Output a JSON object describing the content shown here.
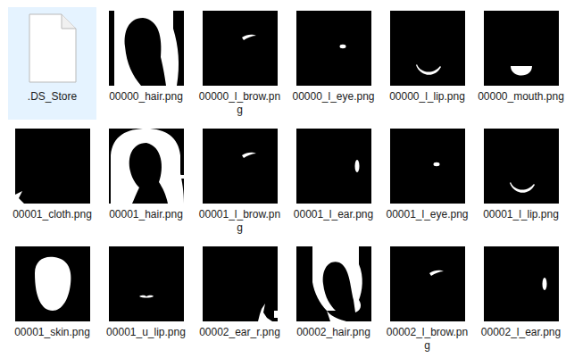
{
  "items": [
    {
      "name": ".DS_Store",
      "kind": "document",
      "selected": true
    },
    {
      "name": "00000_hair.png",
      "kind": "hair",
      "selected": false
    },
    {
      "name": "00000_l_brow.png",
      "kind": "brow",
      "selected": false
    },
    {
      "name": "00000_l_eye.png",
      "kind": "eye",
      "selected": false
    },
    {
      "name": "00000_l_lip.png",
      "kind": "lowerlip",
      "selected": false
    },
    {
      "name": "00000_mouth.png",
      "kind": "mouth",
      "selected": false
    },
    {
      "name": "00001_cloth.png",
      "kind": "cloth",
      "selected": false
    },
    {
      "name": "00001_hair.png",
      "kind": "hairneck",
      "selected": false
    },
    {
      "name": "00001_l_brow.png",
      "kind": "brow",
      "selected": false
    },
    {
      "name": "00001_l_ear.png",
      "kind": "ear",
      "selected": false
    },
    {
      "name": "00001_l_eye.png",
      "kind": "eye",
      "selected": false
    },
    {
      "name": "00001_l_lip.png",
      "kind": "lowerlip",
      "selected": false
    },
    {
      "name": "00001_skin.png",
      "kind": "skin",
      "selected": false
    },
    {
      "name": "00001_u_lip.png",
      "kind": "upperlip",
      "selected": false
    },
    {
      "name": "00002_ear_r.png",
      "kind": "earring",
      "selected": false
    },
    {
      "name": "00002_hair.png",
      "kind": "hairside",
      "selected": false
    },
    {
      "name": "00002_l_brow.png",
      "kind": "brow",
      "selected": false
    },
    {
      "name": "00002_l_ear.png",
      "kind": "ear",
      "selected": false
    }
  ]
}
